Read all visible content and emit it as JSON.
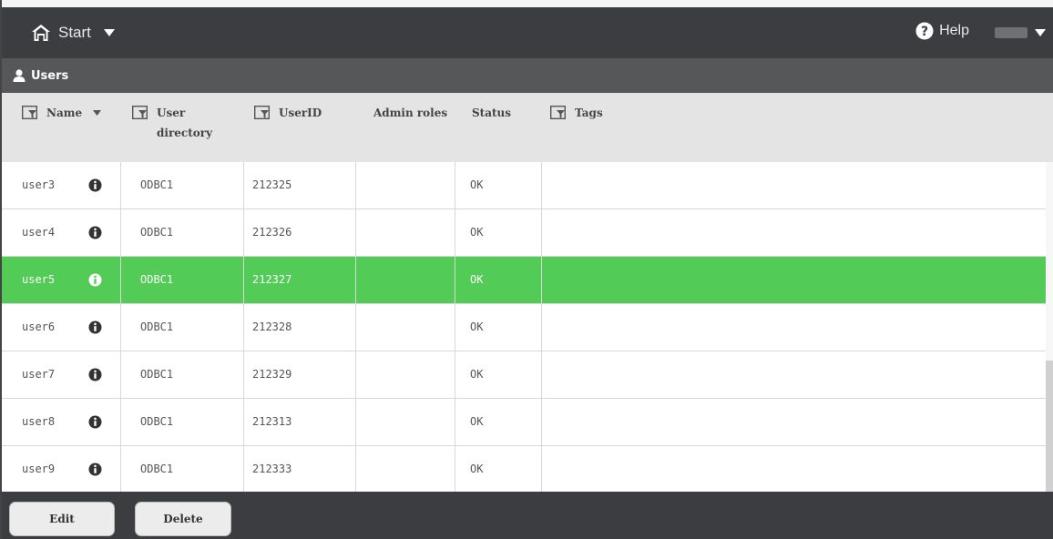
{
  "topbar": {
    "start_label": "Start",
    "help_label": "Help"
  },
  "section": {
    "title": "Users"
  },
  "columns": {
    "name": "Name",
    "user_directory": [
      "User",
      "directory"
    ],
    "user_id": "UserID",
    "admin_roles": "Admin roles",
    "status": "Status",
    "tags": "Tags"
  },
  "rows": [
    {
      "name": "user3",
      "directory": "ODBC1",
      "user_id": "212325",
      "admin_roles": "",
      "status": "OK",
      "tags": ""
    },
    {
      "name": "user4",
      "directory": "ODBC1",
      "user_id": "212326",
      "admin_roles": "",
      "status": "OK",
      "tags": ""
    },
    {
      "name": "user5",
      "directory": "ODBC1",
      "user_id": "212327",
      "admin_roles": "",
      "status": "OK",
      "tags": "",
      "selected": true
    },
    {
      "name": "user6",
      "directory": "ODBC1",
      "user_id": "212328",
      "admin_roles": "",
      "status": "OK",
      "tags": ""
    },
    {
      "name": "user7",
      "directory": "ODBC1",
      "user_id": "212329",
      "admin_roles": "",
      "status": "OK",
      "tags": ""
    },
    {
      "name": "user8",
      "directory": "ODBC1",
      "user_id": "212313",
      "admin_roles": "",
      "status": "OK",
      "tags": ""
    },
    {
      "name": "user9",
      "directory": "ODBC1",
      "user_id": "212333",
      "admin_roles": "",
      "status": "OK",
      "tags": ""
    }
  ],
  "footer": {
    "edit_label": "Edit",
    "delete_label": "Delete"
  },
  "colors": {
    "selected_row": "#52cc57",
    "topbar": "#3b3d40",
    "section": "#555759",
    "header": "#e4e4e4"
  },
  "icons": {
    "start": "home-icon",
    "start_caret": "caret-down-icon",
    "help": "help-circle-icon",
    "user_caret": "caret-down-icon",
    "section": "person-icon",
    "filter": "filter-icon",
    "sort": "sort-desc-icon",
    "row_info": "info-icon"
  }
}
